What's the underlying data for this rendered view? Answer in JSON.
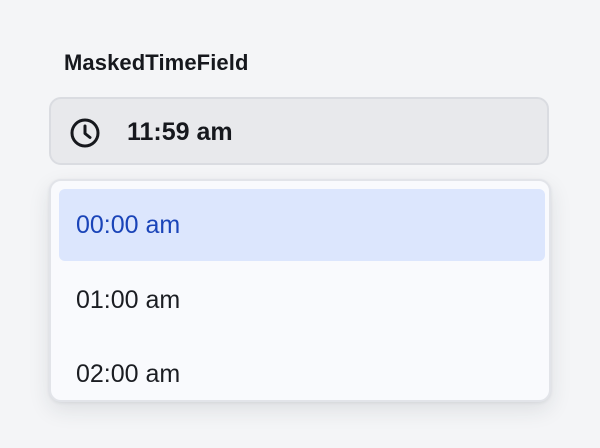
{
  "field": {
    "label": "MaskedTimeField",
    "value": "11:59 am",
    "icon": "clock-icon"
  },
  "dropdown": {
    "options": [
      {
        "label": "00:00 am",
        "selected": true
      },
      {
        "label": "01:00 am",
        "selected": false
      },
      {
        "label": "02:00 am",
        "selected": false
      }
    ]
  },
  "colors": {
    "page_background": "#f4f5f7",
    "input_background": "#e8e9ec",
    "selected_option_background": "#dce6fd",
    "selected_option_text": "#1a44b8",
    "text": "#16181d"
  }
}
